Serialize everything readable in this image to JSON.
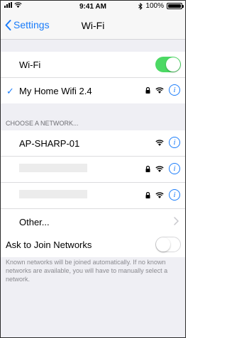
{
  "status_bar": {
    "time": "9:41 AM",
    "battery_text": "100%",
    "battery_level": 1.0
  },
  "nav": {
    "back_label": "Settings",
    "title": "Wi-Fi"
  },
  "wifi_section": {
    "toggle_label": "Wi-Fi",
    "toggle_on": true,
    "connected_network": "My Home Wifi 2.4",
    "checkmark": "✓"
  },
  "networks_section": {
    "header": "CHOOSE A NETWORK...",
    "networks": [
      {
        "name": "AP-SHARP-01",
        "locked": false
      },
      {
        "name": "",
        "locked": true
      },
      {
        "name": "",
        "locked": true
      }
    ],
    "other_label": "Other..."
  },
  "ask_section": {
    "label": "Ask to Join Networks",
    "toggle_on": false,
    "footnote": "Known networks will be joined automatically. If no known networks are available, you will have to manually select a network."
  },
  "colors": {
    "accent": "#1a7cfa",
    "toggle_on": "#4cd964",
    "background": "#efeff4"
  },
  "icons": {
    "info": "info-icon",
    "wifi": "wifi-icon",
    "lock": "lock-icon",
    "chevron": "chevron-right-icon"
  }
}
